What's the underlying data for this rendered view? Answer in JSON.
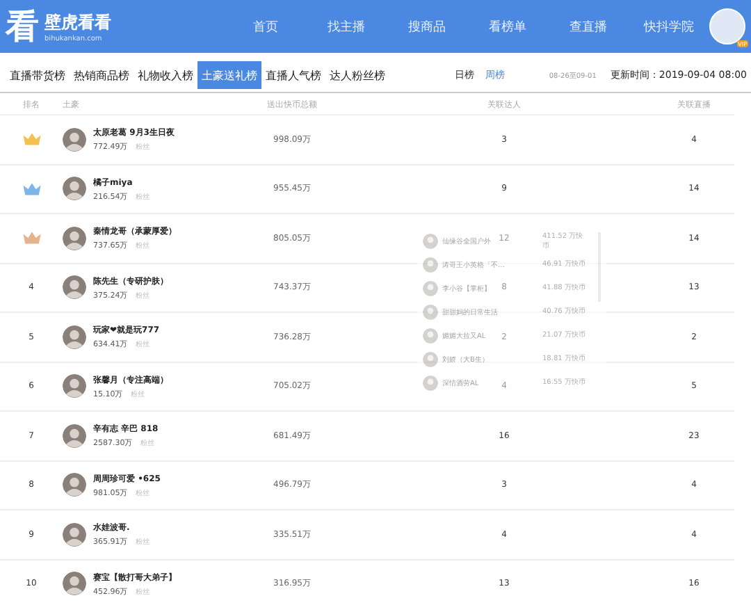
{
  "header": {
    "logo_glyph": "看",
    "brand": "壁虎看看",
    "domain": "bihukankan.com",
    "nav": [
      {
        "label": "首页",
        "selected": false
      },
      {
        "label": "找主播",
        "selected": false
      },
      {
        "label": "搜商品",
        "selected": false
      },
      {
        "label": "看榜单",
        "selected": false
      },
      {
        "label": "查直播",
        "selected": false
      },
      {
        "label": "快抖学院",
        "selected": false
      }
    ],
    "vip_badge": "VIP"
  },
  "tabs": [
    {
      "label": "直播带货榜",
      "selected": false
    },
    {
      "label": "热销商品榜",
      "selected": false
    },
    {
      "label": "礼物收入榜",
      "selected": false
    },
    {
      "label": "土豪送礼榜",
      "selected": true
    },
    {
      "label": "直播人气榜",
      "selected": false
    },
    {
      "label": "达人粉丝榜",
      "selected": false
    }
  ],
  "periods": [
    {
      "label": "日榜",
      "selected": false
    },
    {
      "label": "周榜",
      "selected": true
    }
  ],
  "date_range": "08-26至09-01",
  "update_time": "更新时间：2019-09-04 08:00",
  "table": {
    "columns": [
      "排名",
      "土豪",
      "送出快币总额",
      "关联达人",
      "关联直播"
    ],
    "rows": [
      {
        "rank": {
          "kind": "crown",
          "color": "#f2c14e"
        },
        "name": "太原老葛 9月3生日夜",
        "fans": "772.49万",
        "fans_label": "粉丝",
        "amount": "998.09万",
        "anchors": "3",
        "lives": "4"
      },
      {
        "rank": {
          "kind": "crown",
          "color": "#7fb6ea"
        },
        "name": "橘子miya",
        "fans": "216.54万",
        "fans_label": "粉丝",
        "amount": "955.45万",
        "anchors": "9",
        "lives": "14"
      },
      {
        "rank": {
          "kind": "crown",
          "color": "#e6b38f"
        },
        "name": "秦情龙哥（承蒙厚爱）",
        "fans": "737.65万",
        "fans_label": "粉丝",
        "amount": "805.05万",
        "anchors": "12",
        "lives": "14"
      },
      {
        "rank": {
          "kind": "number",
          "text": "4"
        },
        "name": "陈先生（专研护肤）",
        "fans": "375.24万",
        "fans_label": "粉丝",
        "amount": "743.37万",
        "anchors": "8",
        "lives": "13"
      },
      {
        "rank": {
          "kind": "number",
          "text": "5"
        },
        "name": "玩家❤就是玩777",
        "fans": "634.41万",
        "fans_label": "粉丝",
        "amount": "736.28万",
        "anchors": "2",
        "lives": "2"
      },
      {
        "rank": {
          "kind": "number",
          "text": "6"
        },
        "name": "张馨月（专注高端）",
        "fans": "15.10万",
        "fans_label": "粉丝",
        "amount": "705.02万",
        "anchors": "4",
        "lives": "5"
      },
      {
        "rank": {
          "kind": "number",
          "text": "7"
        },
        "name": "辛有志 辛巴 818",
        "fans": "2587.30万",
        "fans_label": "粉丝",
        "amount": "681.49万",
        "anchors": "16",
        "lives": "23"
      },
      {
        "rank": {
          "kind": "number",
          "text": "8"
        },
        "name": "周周珍可爱 •625",
        "fans": "981.05万",
        "fans_label": "粉丝",
        "amount": "496.79万",
        "anchors": "3",
        "lives": "4"
      },
      {
        "rank": {
          "kind": "number",
          "text": "9"
        },
        "name": "水娃波哥.",
        "fans": "365.91万",
        "fans_label": "粉丝",
        "amount": "335.51万",
        "anchors": "4",
        "lives": "4"
      },
      {
        "rank": {
          "kind": "number",
          "text": "10"
        },
        "name": "赛宝【散打哥大弟子】",
        "fans": "452.96万",
        "fans_label": "粉丝",
        "amount": "316.95万",
        "anchors": "13",
        "lives": "16"
      }
    ]
  },
  "popup": {
    "items": [
      {
        "name": "仙缘谷全国户外",
        "value": "411.52 万快币"
      },
      {
        "name": "涛哥王小英格「不…",
        "value": "46.91 万快币"
      },
      {
        "name": "李小谷【掌柜】",
        "value": "41.88 万快币"
      },
      {
        "name": "甜甜妈的日常生活",
        "value": "40.76 万快币"
      },
      {
        "name": "媚媚大拉又AL",
        "value": "21.07 万快币"
      },
      {
        "name": "刘娇（大B生）",
        "value": "18.81 万快币"
      },
      {
        "name": "深情酒劳AL",
        "value": "16.55 万快币"
      }
    ]
  }
}
